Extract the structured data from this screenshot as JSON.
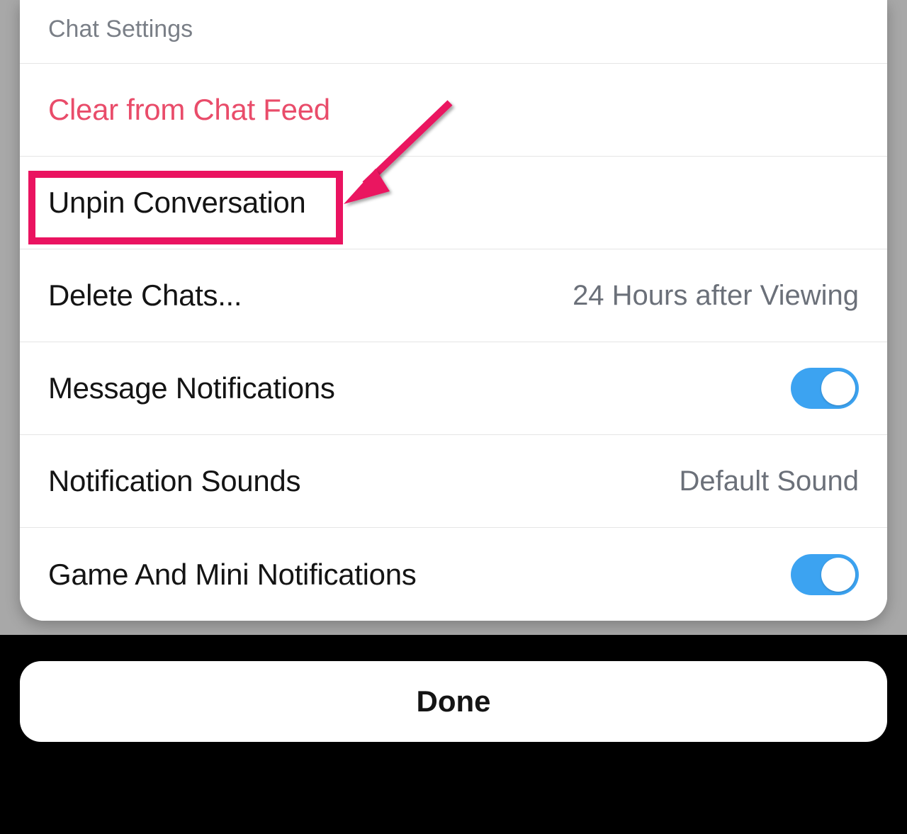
{
  "header": {
    "title": "Chat Settings"
  },
  "rows": {
    "clear": {
      "label": "Clear from Chat Feed"
    },
    "unpin": {
      "label": "Unpin Conversation"
    },
    "delete": {
      "label": "Delete Chats...",
      "value": "24 Hours after Viewing"
    },
    "msg_notif": {
      "label": "Message Notifications",
      "toggle": true
    },
    "notif_sounds": {
      "label": "Notification Sounds",
      "value": "Default Sound"
    },
    "game_mini": {
      "label": "Game And Mini Notifications",
      "toggle": true
    }
  },
  "done": {
    "label": "Done"
  },
  "annotation": {
    "highlight_target": "unpin-conversation-row"
  },
  "colors": {
    "destructive": "#e94c6a",
    "toggle_on": "#3ca3f1",
    "highlight": "#ea1360"
  }
}
